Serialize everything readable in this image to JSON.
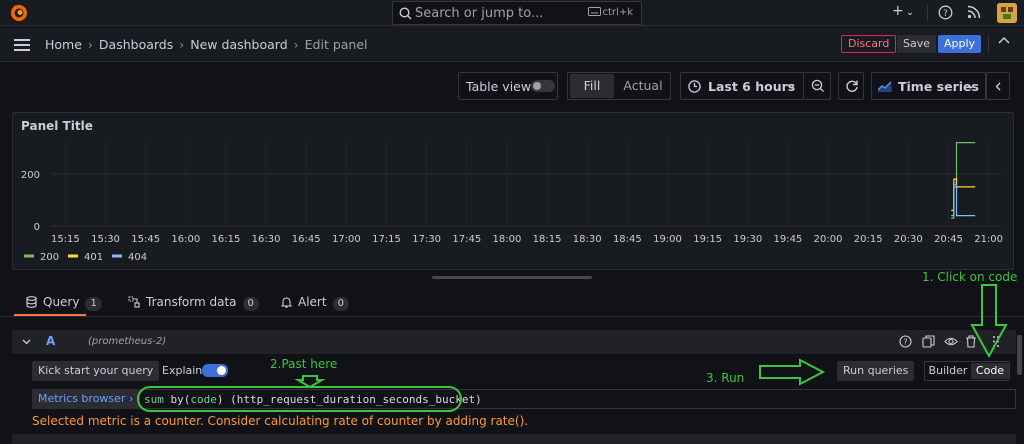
{
  "topbar": {
    "search_placeholder": "Search or jump to...",
    "shortcut": "ctrl+k",
    "plus_icon": "+",
    "caret": "⌄",
    "help_icon": "?",
    "news_icon": "rss-icon"
  },
  "breadcrumbs": {
    "items": [
      "Home",
      "Dashboards",
      "New dashboard",
      "Edit panel"
    ],
    "separator": "›"
  },
  "actions": {
    "discard": "Discard",
    "save": "Save",
    "apply": "Apply",
    "collapse": "⌃"
  },
  "toolbar": {
    "table_view": "Table view",
    "table_view_on": false,
    "fill": "Fill",
    "actual": "Actual",
    "time_range": "Last 6 hours",
    "visualization": "Time series"
  },
  "panel": {
    "title": "Panel Title"
  },
  "chart_data": {
    "type": "line",
    "title": "Panel Title",
    "x_ticks": [
      "15:15",
      "15:30",
      "15:45",
      "16:00",
      "16:15",
      "16:30",
      "16:45",
      "17:00",
      "17:15",
      "17:30",
      "17:45",
      "18:00",
      "18:15",
      "18:30",
      "18:45",
      "19:00",
      "19:15",
      "19:30",
      "19:45",
      "20:00",
      "20:15",
      "20:30",
      "20:45",
      "21:00"
    ],
    "y_ticks": [
      "0",
      "200"
    ],
    "ylim": [
      0,
      330
    ],
    "grid": true,
    "legend_placement": "bottom-left",
    "series": [
      {
        "name": "200",
        "color": "#73bf69",
        "x": [
          "20:46",
          "20:47",
          "20:47",
          "20:48",
          "20:48",
          "20:55"
        ],
        "values": [
          30,
          30,
          150,
          150,
          320,
          320
        ]
      },
      {
        "name": "401",
        "color": "#fade2a",
        "x": [
          "20:46",
          "20:47",
          "20:47",
          "20:48",
          "20:48",
          "20:55"
        ],
        "values": [
          60,
          60,
          180,
          180,
          150,
          150
        ]
      },
      {
        "name": "404",
        "color": "#8ab8ff",
        "x": [
          "20:46",
          "20:47",
          "20:47",
          "20:48",
          "20:48",
          "20:55"
        ],
        "values": [
          40,
          40,
          160,
          160,
          40,
          40
        ]
      }
    ]
  },
  "tabs": [
    {
      "label": "Query",
      "count": "1"
    },
    {
      "label": "Transform data",
      "count": "0"
    },
    {
      "label": "Alert",
      "count": "0"
    }
  ],
  "query": {
    "name": "A",
    "datasource": "(prometheus-2)",
    "kick_start": "Kick start your query",
    "explain": "Explain",
    "explain_on": true,
    "run": "Run queries",
    "builder": "Builder",
    "code": "Code",
    "metrics_browser": "Metrics browser",
    "metrics_browser_caret": "›",
    "expr_fn": "sum",
    "expr_by": " by(",
    "expr_label": "code",
    "expr_rest": ") (http_request_duration_seconds_bucket)",
    "warning": "Selected metric is a counter. Consider calculating rate of counter by adding rate()."
  },
  "annotations": {
    "step1": "1. Click on code",
    "step2": "2.Past here",
    "step3": "3. Run"
  },
  "colors": {
    "accent_orange": "#f5783d",
    "annotation_green": "#3ec43e",
    "apply_blue": "#3d71d9",
    "warning": "#ff9830"
  }
}
